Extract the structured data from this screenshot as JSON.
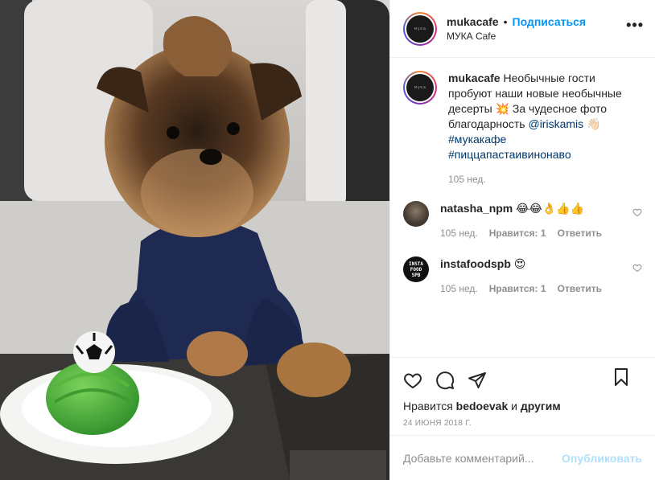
{
  "post": {
    "photo_alt": "",
    "header": {
      "username": "mukacafe",
      "separator": "•",
      "follow_label": "Подписаться",
      "location": "МУКА Cafe",
      "more_label": "•••",
      "avatar_text": "мука"
    },
    "caption": {
      "username": "mukacafe",
      "text_1": " Необычные гости пробуют наши новые необычные десерты ",
      "emoji_1": "💥",
      "text_2": " За чудесное фото благодарность ",
      "mention": "@iriskamis",
      "emoji_2": " 👋🏻 ",
      "hashtag_1": "#мукакафе",
      "hashtag_2": "#пиццапастаивинонаво",
      "time": "105 нед."
    },
    "comments": [
      {
        "username": "natasha_npm",
        "text": " 😂😂👌👍👍",
        "time": "105 нед.",
        "likes": "Нравится: 1",
        "reply": "Ответить"
      },
      {
        "username": "instafoodspb",
        "text": " 😍",
        "time": "105 нед.",
        "likes": "Нравится: 1",
        "reply": "Ответить",
        "avatar_lines": [
          "INSTA",
          "FOOD",
          "SPB"
        ]
      }
    ],
    "likes_line": {
      "prefix": "Нравится ",
      "user": "bedoevak",
      "middle": " и ",
      "suffix": "другим"
    },
    "date": "24 ИЮНЯ 2018 Г.",
    "add_comment": {
      "placeholder": "Добавьте комментарий...",
      "publish_label": "Опубликовать"
    },
    "icons": {
      "like": "heart-icon",
      "comment": "comment-icon",
      "share": "share-icon",
      "save": "bookmark-icon",
      "more": "more-icon"
    },
    "colors": {
      "link_blue": "#0095f6",
      "tag_blue": "#00376b",
      "muted": "#8e8e8e",
      "publish_disabled": "#b2dffc"
    }
  }
}
